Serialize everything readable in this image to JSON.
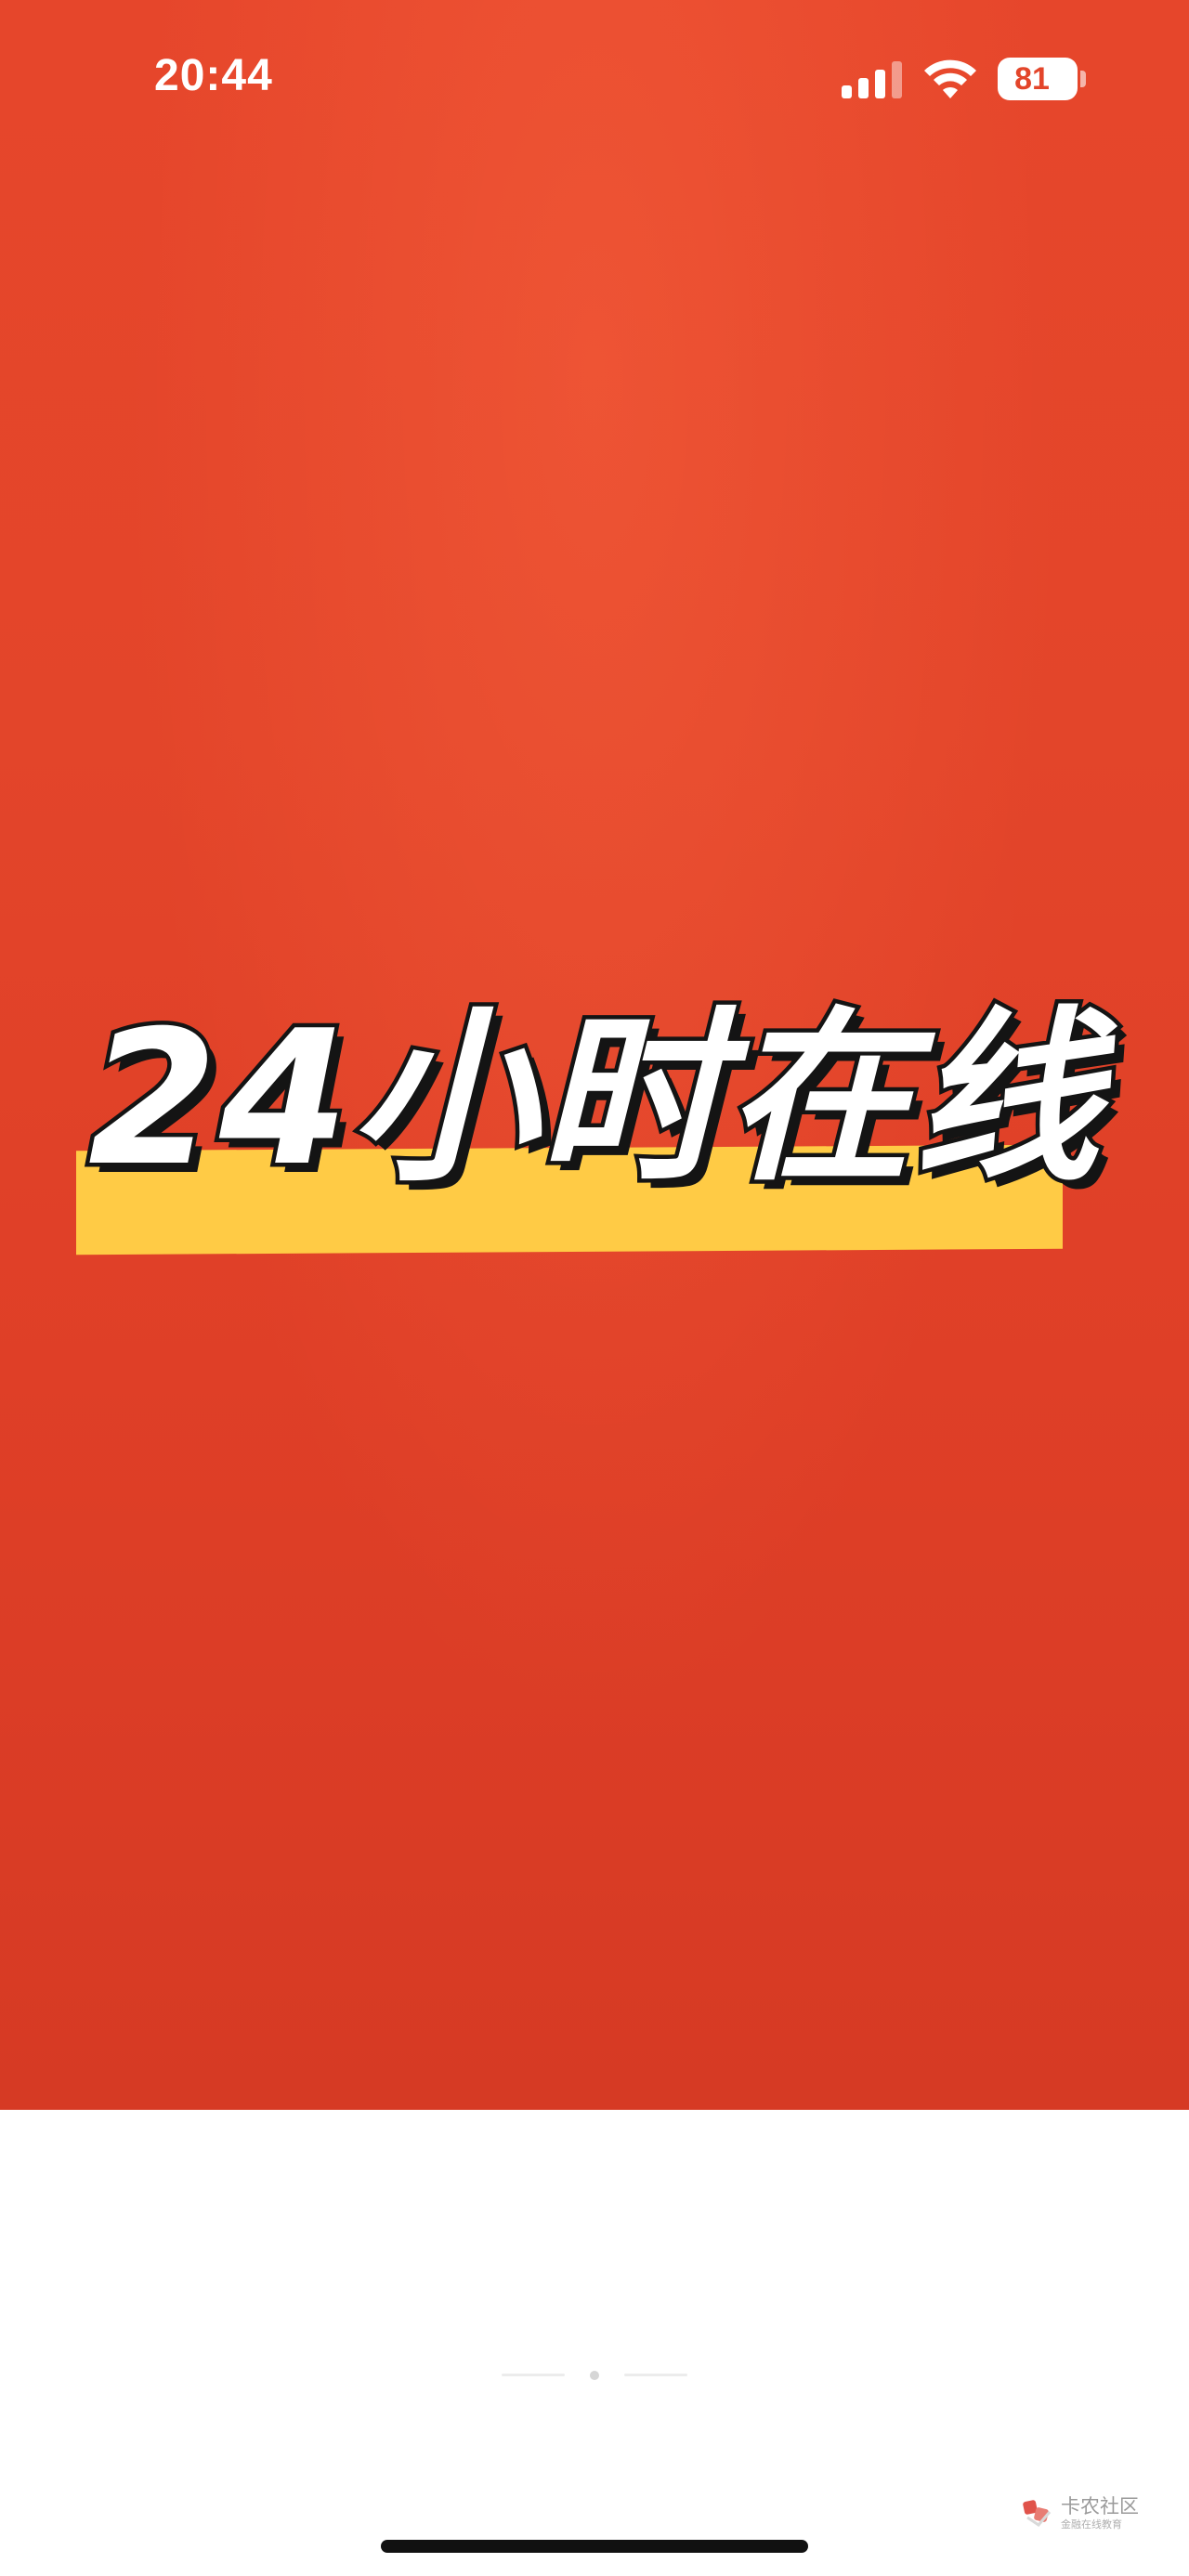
{
  "status_bar": {
    "time": "20:44",
    "battery_level": "81",
    "signal_bars_filled": 3,
    "signal_bars_total": 4
  },
  "poster": {
    "headline": "24小时在线",
    "background_color": "#e3452a",
    "highlight_color": "#ffcb45"
  },
  "pager": {
    "page_count": 3,
    "current_page": 2
  },
  "watermark": {
    "title": "卡农社区",
    "subtitle": "金融在线教育"
  }
}
